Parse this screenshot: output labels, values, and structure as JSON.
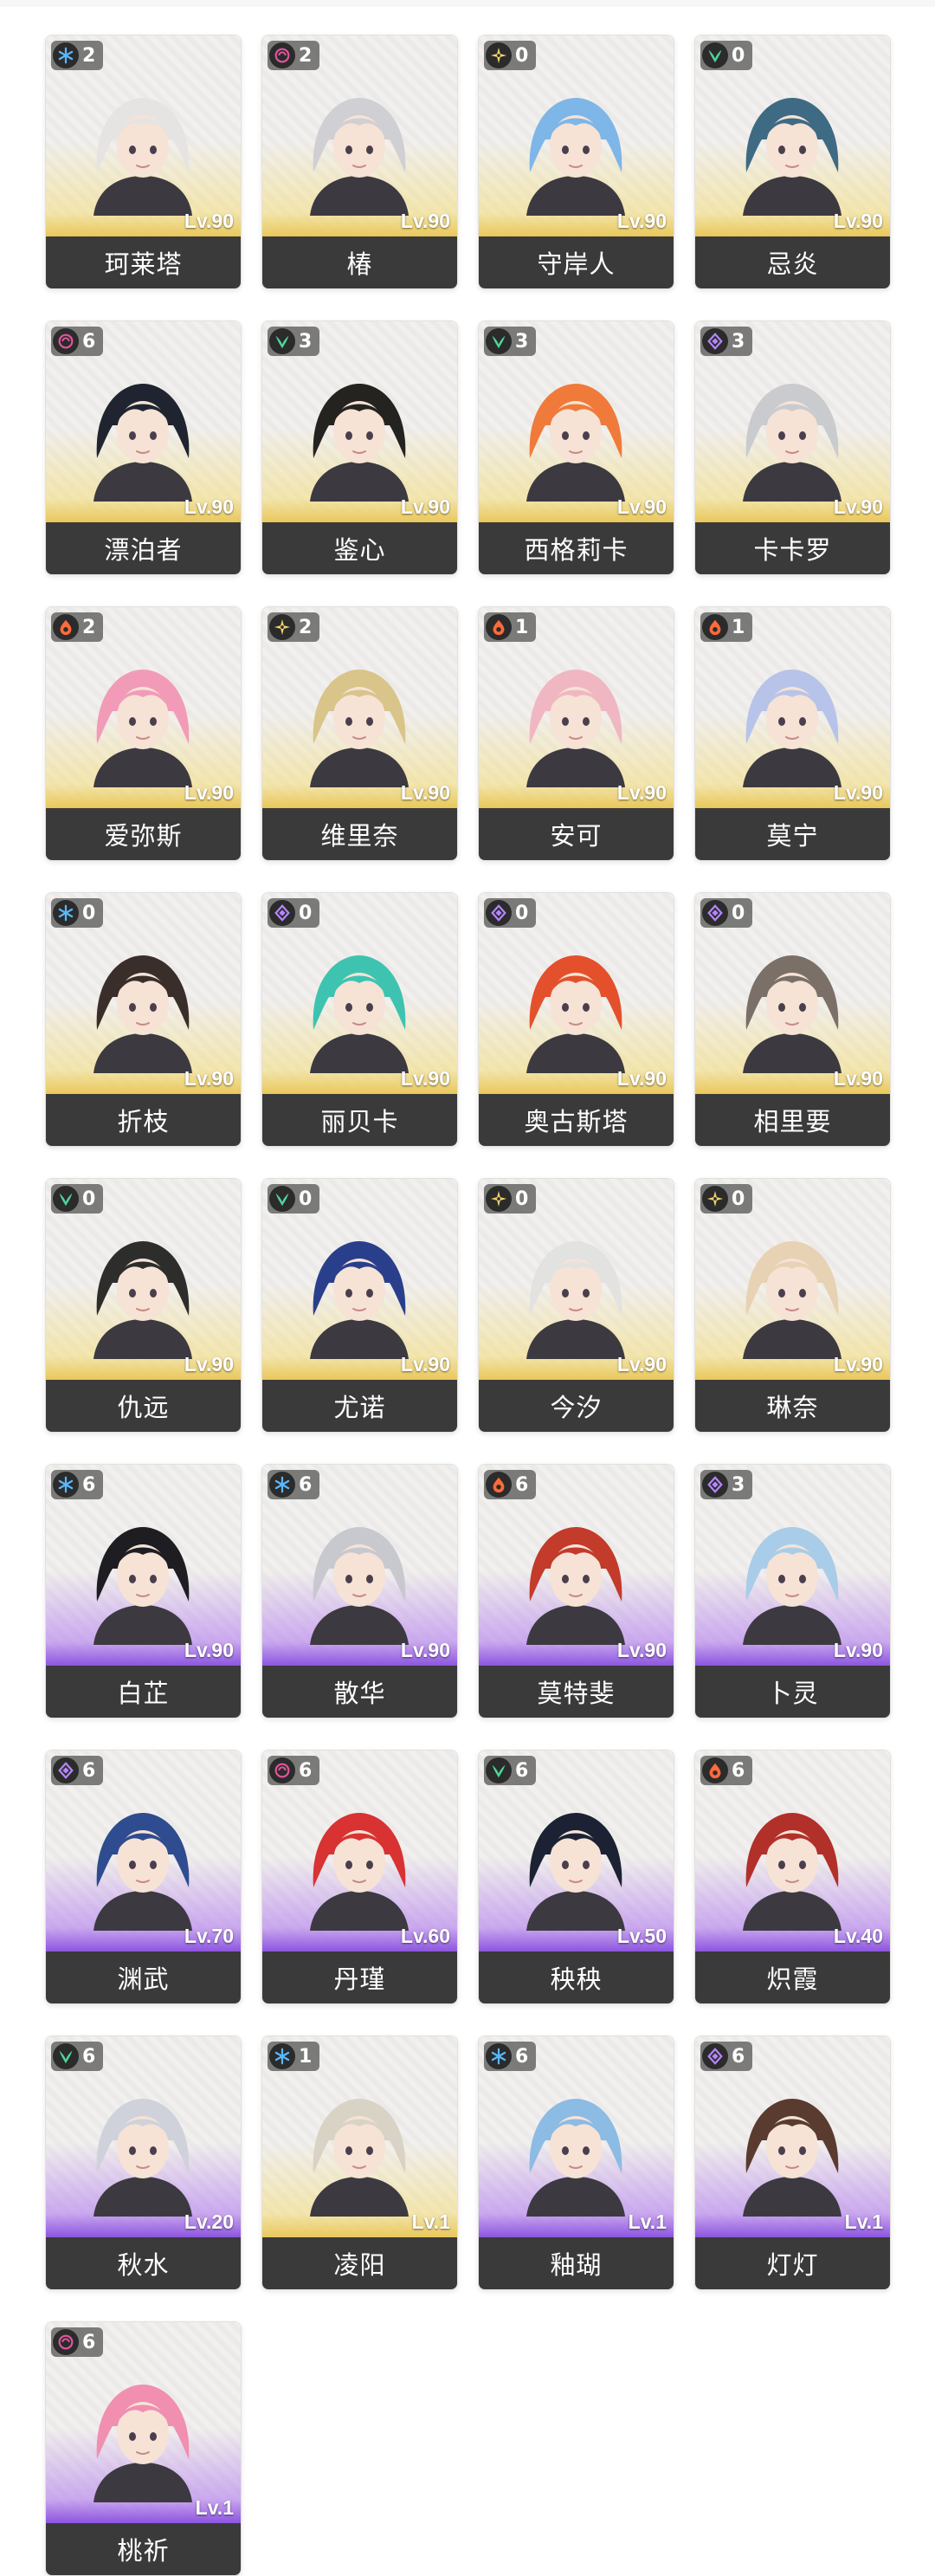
{
  "elements": {
    "glacio": {
      "icon": "glacio-element-icon",
      "color": "#5ab8ff"
    },
    "havoc": {
      "icon": "havoc-element-icon",
      "color": "#e0559c"
    },
    "spectro": {
      "icon": "spectro-element-icon",
      "color": "#f2d36b"
    },
    "aero": {
      "icon": "aero-element-icon",
      "color": "#4fd69a"
    },
    "fusion": {
      "icon": "fusion-element-icon",
      "color": "#ff6a3a"
    },
    "electro": {
      "icon": "electro-element-icon",
      "color": "#b486ff"
    }
  },
  "rarity_colors": {
    "gold": "#e9c85a",
    "purple": "#8d55e0"
  },
  "characters": [
    {
      "name": "珂莱塔",
      "element": "glacio",
      "dupes": "2",
      "level": "Lv.90",
      "rarity": "gold",
      "hair": "#e6e3e3"
    },
    {
      "name": "椿",
      "element": "havoc",
      "dupes": "2",
      "level": "Lv.90",
      "rarity": "gold",
      "hair": "#cfcfd4"
    },
    {
      "name": "守岸人",
      "element": "spectro",
      "dupes": "0",
      "level": "Lv.90",
      "rarity": "gold",
      "hair": "#7eb6e8"
    },
    {
      "name": "忌炎",
      "element": "aero",
      "dupes": "0",
      "level": "Lv.90",
      "rarity": "gold",
      "hair": "#3f6a84"
    },
    {
      "name": "漂泊者",
      "element": "havoc",
      "dupes": "6",
      "level": "Lv.90",
      "rarity": "gold",
      "hair": "#1f2430"
    },
    {
      "name": "鉴心",
      "element": "aero",
      "dupes": "3",
      "level": "Lv.90",
      "rarity": "gold",
      "hair": "#24231f"
    },
    {
      "name": "西格莉卡",
      "element": "aero",
      "dupes": "3",
      "level": "Lv.90",
      "rarity": "gold",
      "hair": "#f07a3a"
    },
    {
      "name": "卡卡罗",
      "element": "electro",
      "dupes": "3",
      "level": "Lv.90",
      "rarity": "gold",
      "hair": "#c9cbcf"
    },
    {
      "name": "爱弥斯",
      "element": "fusion",
      "dupes": "2",
      "level": "Lv.90",
      "rarity": "gold",
      "hair": "#f29bb8"
    },
    {
      "name": "维里奈",
      "element": "spectro",
      "dupes": "2",
      "level": "Lv.90",
      "rarity": "gold",
      "hair": "#d9c48a"
    },
    {
      "name": "安可",
      "element": "fusion",
      "dupes": "1",
      "level": "Lv.90",
      "rarity": "gold",
      "hair": "#f0b7c2"
    },
    {
      "name": "莫宁",
      "element": "fusion",
      "dupes": "1",
      "level": "Lv.90",
      "rarity": "gold",
      "hair": "#b8c3ea"
    },
    {
      "name": "折枝",
      "element": "glacio",
      "dupes": "0",
      "level": "Lv.90",
      "rarity": "gold",
      "hair": "#3a2e2a"
    },
    {
      "name": "丽贝卡",
      "element": "electro",
      "dupes": "0",
      "level": "Lv.90",
      "rarity": "gold",
      "hair": "#3ec3b1"
    },
    {
      "name": "奥古斯塔",
      "element": "electro",
      "dupes": "0",
      "level": "Lv.90",
      "rarity": "gold",
      "hair": "#e4502c"
    },
    {
      "name": "相里要",
      "element": "electro",
      "dupes": "0",
      "level": "Lv.90",
      "rarity": "gold",
      "hair": "#7b7068"
    },
    {
      "name": "仇远",
      "element": "aero",
      "dupes": "0",
      "level": "Lv.90",
      "rarity": "gold",
      "hair": "#2d2e2b"
    },
    {
      "name": "尤诺",
      "element": "aero",
      "dupes": "0",
      "level": "Lv.90",
      "rarity": "gold",
      "hair": "#2a3f8c"
    },
    {
      "name": "今汐",
      "element": "spectro",
      "dupes": "0",
      "level": "Lv.90",
      "rarity": "gold",
      "hair": "#e2e2e0"
    },
    {
      "name": "琳奈",
      "element": "spectro",
      "dupes": "0",
      "level": "Lv.90",
      "rarity": "gold",
      "hair": "#e8d2b4"
    },
    {
      "name": "白芷",
      "element": "glacio",
      "dupes": "6",
      "level": "Lv.90",
      "rarity": "purple",
      "hair": "#1d1d22"
    },
    {
      "name": "散华",
      "element": "glacio",
      "dupes": "6",
      "level": "Lv.90",
      "rarity": "purple",
      "hair": "#c8c8cf"
    },
    {
      "name": "莫特斐",
      "element": "fusion",
      "dupes": "6",
      "level": "Lv.90",
      "rarity": "purple",
      "hair": "#c23b2b"
    },
    {
      "name": "卜灵",
      "element": "electro",
      "dupes": "3",
      "level": "Lv.90",
      "rarity": "purple",
      "hair": "#a9cde8"
    },
    {
      "name": "渊武",
      "element": "electro",
      "dupes": "6",
      "level": "Lv.70",
      "rarity": "purple",
      "hair": "#2e4c8f"
    },
    {
      "name": "丹瑾",
      "element": "havoc",
      "dupes": "6",
      "level": "Lv.60",
      "rarity": "purple",
      "hair": "#d83232"
    },
    {
      "name": "秧秧",
      "element": "aero",
      "dupes": "6",
      "level": "Lv.50",
      "rarity": "purple",
      "hair": "#1c2234"
    },
    {
      "name": "炽霞",
      "element": "fusion",
      "dupes": "6",
      "level": "Lv.40",
      "rarity": "purple",
      "hair": "#b2302a"
    },
    {
      "name": "秋水",
      "element": "aero",
      "dupes": "6",
      "level": "Lv.20",
      "rarity": "purple",
      "hair": "#cfd2da"
    },
    {
      "name": "凌阳",
      "element": "glacio",
      "dupes": "1",
      "level": "Lv.1",
      "rarity": "gold",
      "hair": "#d9d3c6"
    },
    {
      "name": "釉瑚",
      "element": "glacio",
      "dupes": "6",
      "level": "Lv.1",
      "rarity": "purple",
      "hair": "#8cbbe4"
    },
    {
      "name": "灯灯",
      "element": "electro",
      "dupes": "6",
      "level": "Lv.1",
      "rarity": "purple",
      "hair": "#5a3b30"
    },
    {
      "name": "桃祈",
      "element": "havoc",
      "dupes": "6",
      "level": "Lv.1",
      "rarity": "purple",
      "hair": "#f08fb0"
    }
  ]
}
